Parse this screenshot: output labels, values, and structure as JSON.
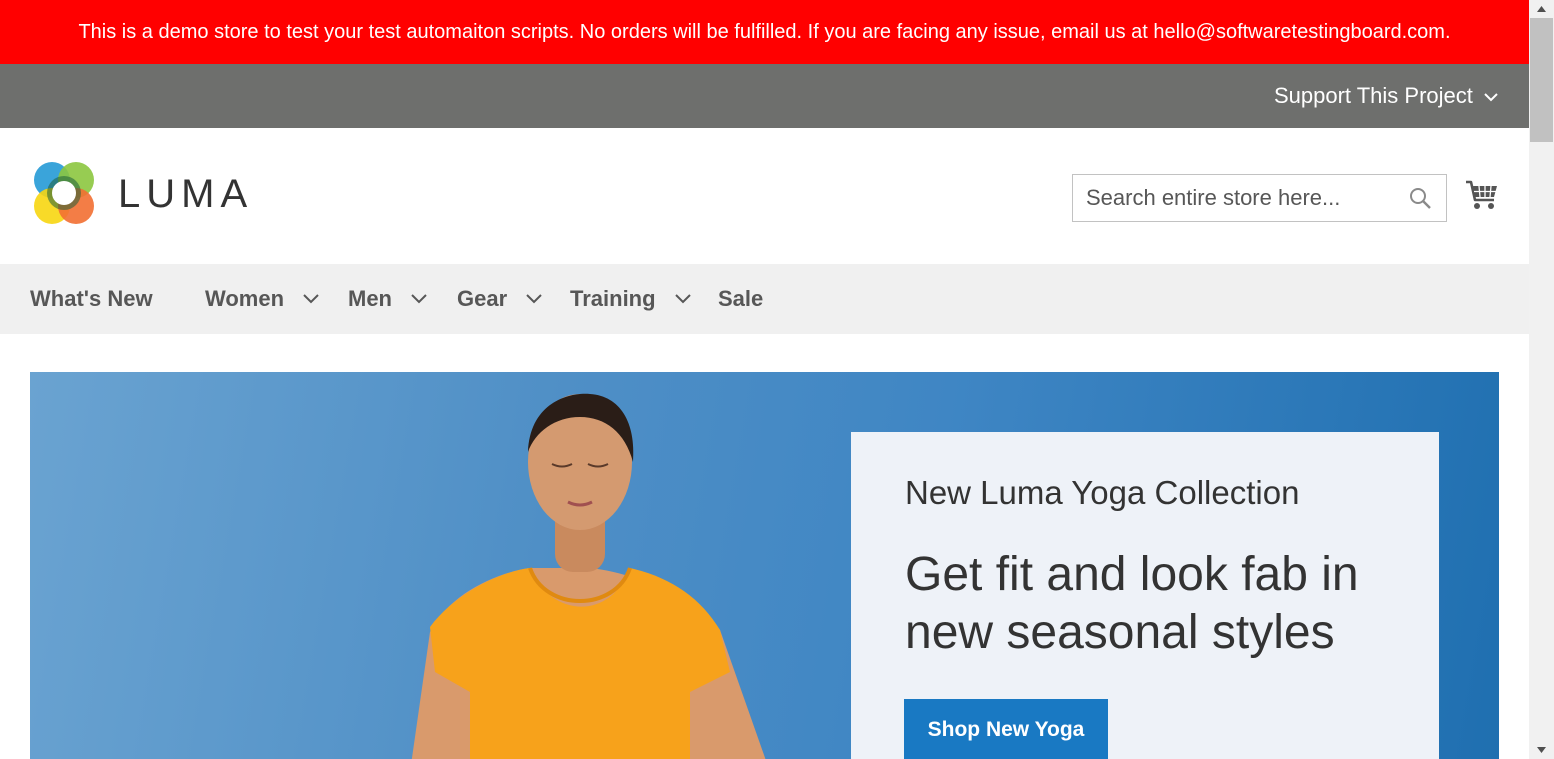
{
  "notice": {
    "text": "This is a demo store to test your test automaiton scripts. No orders will be fulfilled. If you are facing any issue, email us at hello@softwaretestingboard.com."
  },
  "support": {
    "label": "Support This Project"
  },
  "logo": {
    "text": "LUMA"
  },
  "search": {
    "placeholder": "Search entire store here..."
  },
  "nav": {
    "items": [
      {
        "label": "What's New"
      },
      {
        "label": "Women"
      },
      {
        "label": "Men"
      },
      {
        "label": "Gear"
      },
      {
        "label": "Training"
      },
      {
        "label": "Sale"
      }
    ]
  },
  "hero": {
    "subtitle": "New Luma Yoga Collection",
    "title": "Get fit and look fab in new seasonal styles",
    "button_label": "Shop New Yoga"
  },
  "colors": {
    "notice_bg": "#ff0000",
    "support_bar_bg": "#6e6f6d",
    "nav_bg": "#f0f0f0",
    "button_blue": "#1979c3"
  },
  "icons": [
    "chevron-down-icon",
    "search-icon",
    "cart-icon",
    "luma-logo-icon"
  ]
}
